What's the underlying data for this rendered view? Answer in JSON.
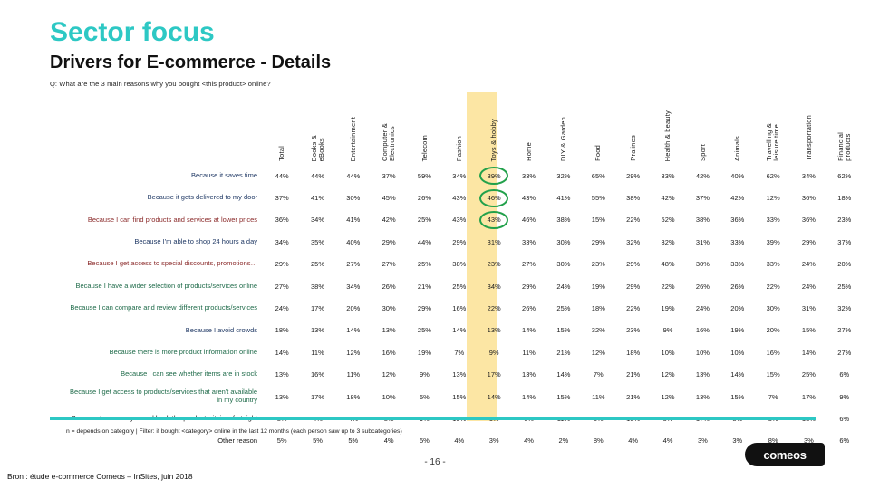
{
  "slide": {
    "title": "Sector focus",
    "subtitle": "Drivers for E-commerce - Details",
    "question": "Q: What are the 3 main reasons why you bought <this product> online?",
    "footnote": "n = depends on category | Filter: if bought <category> online in the last 12 months (each person saw up to 3 subcategories)",
    "page_number": "- 16 -",
    "source": "Bron : étude e-commerce Comeos – InSites, juin 2018",
    "logo_text": "comeos",
    "accent_color": "#2DC8C4",
    "highlight_color": "#FCE6A4",
    "ellipse_color": "#22A14B"
  },
  "chart_data": {
    "type": "table",
    "title": "Drivers for E-commerce - Details",
    "highlight_column": "Toys & hobby",
    "categories": [
      "Total",
      "Books &\neBooks",
      "Entertainment",
      "Computer &\nElectronics",
      "Telecom",
      "Fashion",
      "Toys & hobby",
      "Home",
      "DIY & Garden",
      "Food",
      "Pralines",
      "Health & beauty",
      "Sport",
      "Animals",
      "Travelling &\nleisure time",
      "Transportation",
      "Financial\nproducts"
    ],
    "rows": [
      {
        "label": "Because it saves time",
        "color": "#1F3864",
        "circled": true,
        "values": [
          "44%",
          "44%",
          "44%",
          "37%",
          "59%",
          "34%",
          "39%",
          "33%",
          "32%",
          "65%",
          "29%",
          "33%",
          "42%",
          "40%",
          "62%",
          "34%",
          "62%"
        ]
      },
      {
        "label": "Because it gets delivered to my door",
        "color": "#1F3864",
        "circled": true,
        "values": [
          "37%",
          "41%",
          "30%",
          "45%",
          "26%",
          "43%",
          "46%",
          "43%",
          "41%",
          "55%",
          "38%",
          "42%",
          "37%",
          "42%",
          "12%",
          "36%",
          "18%"
        ]
      },
      {
        "label": "Because I can find products and services at lower prices",
        "color": "#8B2B2B",
        "circled": true,
        "values": [
          "36%",
          "34%",
          "41%",
          "42%",
          "25%",
          "43%",
          "43%",
          "46%",
          "38%",
          "15%",
          "22%",
          "52%",
          "38%",
          "36%",
          "33%",
          "36%",
          "23%"
        ]
      },
      {
        "label": "Because I'm able to shop 24 hours a day",
        "color": "#1F3864",
        "circled": false,
        "values": [
          "34%",
          "35%",
          "40%",
          "29%",
          "44%",
          "29%",
          "31%",
          "33%",
          "30%",
          "29%",
          "32%",
          "32%",
          "31%",
          "33%",
          "39%",
          "29%",
          "37%"
        ]
      },
      {
        "label": "Because I get access to special discounts, promotions…",
        "color": "#8B2B2B",
        "circled": false,
        "values": [
          "29%",
          "25%",
          "27%",
          "27%",
          "25%",
          "38%",
          "23%",
          "27%",
          "30%",
          "23%",
          "29%",
          "48%",
          "30%",
          "33%",
          "33%",
          "24%",
          "20%"
        ]
      },
      {
        "label": "Because I have a wider selection of products/services online",
        "color": "#1F6B4A",
        "circled": false,
        "values": [
          "27%",
          "38%",
          "34%",
          "26%",
          "21%",
          "25%",
          "34%",
          "29%",
          "24%",
          "19%",
          "29%",
          "22%",
          "26%",
          "26%",
          "22%",
          "24%",
          "25%"
        ]
      },
      {
        "label": "Because I can compare and review different products/services",
        "color": "#1F6B4A",
        "circled": false,
        "values": [
          "24%",
          "17%",
          "20%",
          "30%",
          "29%",
          "16%",
          "22%",
          "26%",
          "25%",
          "18%",
          "22%",
          "19%",
          "24%",
          "20%",
          "30%",
          "31%",
          "32%"
        ]
      },
      {
        "label": "Because I avoid crowds",
        "color": "#1F3864",
        "circled": false,
        "values": [
          "18%",
          "13%",
          "14%",
          "13%",
          "25%",
          "14%",
          "13%",
          "14%",
          "15%",
          "32%",
          "23%",
          "9%",
          "16%",
          "19%",
          "20%",
          "15%",
          "27%"
        ]
      },
      {
        "label": "Because there is more product information online",
        "color": "#1F6B4A",
        "circled": false,
        "values": [
          "14%",
          "11%",
          "12%",
          "16%",
          "19%",
          "7%",
          "9%",
          "11%",
          "21%",
          "12%",
          "18%",
          "10%",
          "10%",
          "10%",
          "16%",
          "14%",
          "27%"
        ]
      },
      {
        "label": "Because I can see whether items are in stock",
        "color": "#1F6B4A",
        "circled": false,
        "values": [
          "13%",
          "16%",
          "11%",
          "12%",
          "9%",
          "13%",
          "17%",
          "13%",
          "14%",
          "7%",
          "21%",
          "12%",
          "13%",
          "14%",
          "15%",
          "25%",
          "6%"
        ]
      },
      {
        "label": "Because I get access to products/services that aren't available\nin my country",
        "color": "#1F6B4A",
        "circled": false,
        "values": [
          "13%",
          "17%",
          "18%",
          "10%",
          "5%",
          "15%",
          "14%",
          "14%",
          "15%",
          "11%",
          "21%",
          "12%",
          "13%",
          "15%",
          "7%",
          "17%",
          "9%"
        ]
      },
      {
        "label": "Because I can always send back the product within a fortnight",
        "color": "#111111",
        "circled": false,
        "values": [
          "8%",
          "4%",
          "4%",
          "8%",
          "9%",
          "19%",
          "6%",
          "6%",
          "11%",
          "5%",
          "13%",
          "5%",
          "17%",
          "8%",
          "3%",
          "13%",
          "6%"
        ]
      },
      {
        "label": "Other reason",
        "color": "#1a1a1a",
        "circled": false,
        "values": [
          "5%",
          "5%",
          "5%",
          "4%",
          "5%",
          "4%",
          "3%",
          "4%",
          "2%",
          "8%",
          "4%",
          "4%",
          "3%",
          "3%",
          "8%",
          "3%",
          "6%"
        ]
      }
    ]
  }
}
